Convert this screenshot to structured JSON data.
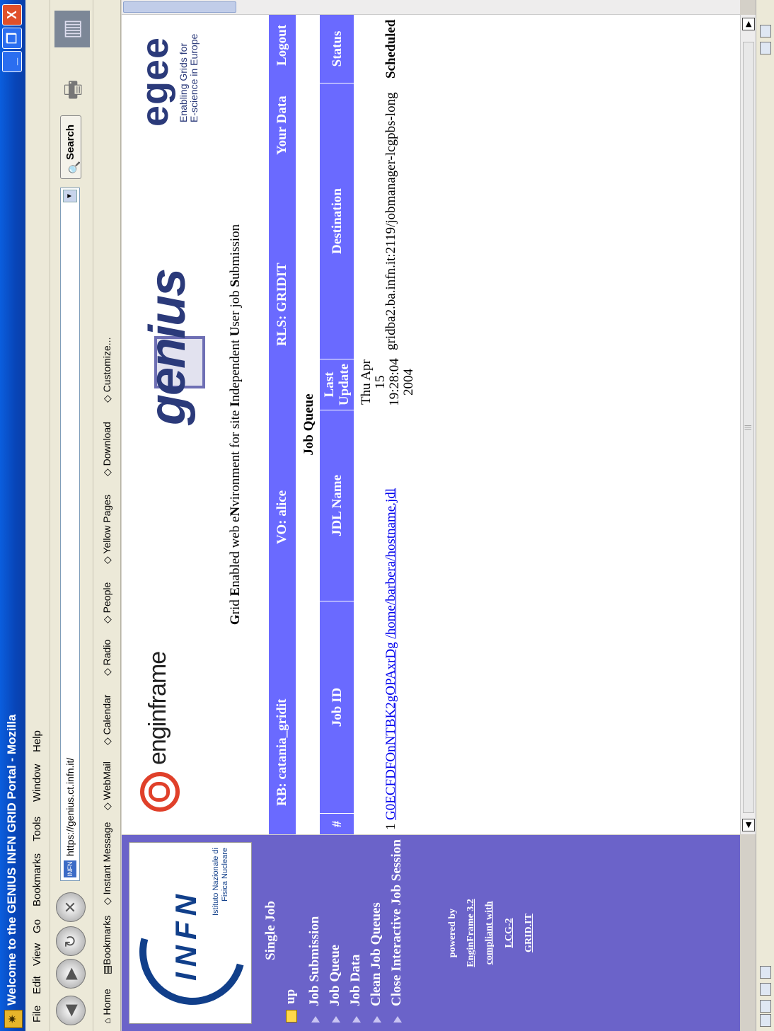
{
  "window": {
    "title": "Welcome to the GENIUS INFN GRID Portal - Mozilla",
    "min": "_",
    "max": "❐",
    "close": "X"
  },
  "menu": [
    "File",
    "Edit",
    "View",
    "Go",
    "Bookmarks",
    "Tools",
    "Window",
    "Help"
  ],
  "nav": {
    "url": "https://genius.ct.infn.it/",
    "search_label": "Search"
  },
  "bookmarks": [
    "Home",
    "Bookmarks",
    "Instant Message",
    "WebMail",
    "Calendar",
    "Radio",
    "People",
    "Yellow Pages",
    "Download",
    "Customize..."
  ],
  "sidebar": {
    "logo_text": "INFN",
    "logo_sub": "Istituto Nazionale di Fisica Nucleare",
    "heading": "Single Job",
    "up": "up",
    "links": [
      "Job Submission",
      "Job Queue",
      "Job Data",
      "Clean Job Queues",
      "Close Interactive Job Session"
    ],
    "powered": [
      "powered by",
      "EnginFrame 3.2",
      "compliant with",
      "LCG-2",
      "GRID.IT"
    ]
  },
  "header": {
    "engin_text": "enginframe",
    "genius_text": "genius",
    "egee_text": "egee",
    "egee_sub1": "Enabling Grids for",
    "egee_sub2": "E-science in Europe",
    "tagline": [
      {
        "b": "G",
        "t": "rid "
      },
      {
        "b": "E",
        "t": "nabled web e"
      },
      {
        "b": "N",
        "t": "vironment for site "
      },
      {
        "b": "I",
        "t": "ndependent "
      },
      {
        "b": "U",
        "t": "ser job "
      },
      {
        "b": "S",
        "t": "ubmission"
      }
    ]
  },
  "infobar": {
    "rb": "RB: catania_gridit",
    "vo": "VO: alice",
    "rls": "RLS: GRIDIT",
    "yourdata": "Your Data",
    "logout": "Logout"
  },
  "table": {
    "title": "Job Queue",
    "headers": {
      "num": "#",
      "jobid": "Job ID",
      "jdl": "JDL Name",
      "last1": "Last",
      "last2": "Update",
      "dest": "Destination",
      "status": "Status"
    },
    "rows": [
      {
        "num": "1",
        "jobid": "G0ECFDFOnNTBK2gOPAxrDg",
        "jdl": "/home/barbera/hostname.jdl",
        "update": [
          "Thu Apr",
          "15",
          "19:28:04",
          "2004"
        ],
        "dest": "gridba2.ba.infn.it:2119/jobmanager-lcgpbs-long",
        "status": "Scheduled"
      }
    ]
  }
}
